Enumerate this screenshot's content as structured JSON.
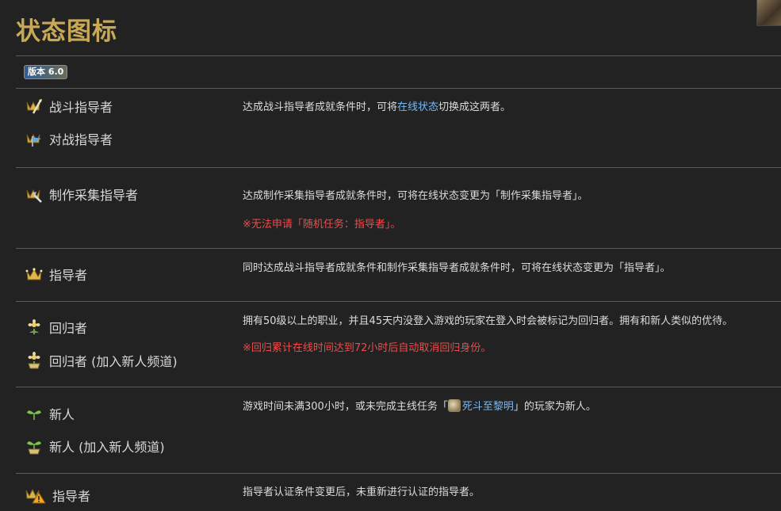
{
  "page": {
    "title": "状态图标"
  },
  "version_badge": "版本 6.0",
  "rows": [
    {
      "statuses": [
        {
          "label": "战斗指导者",
          "icon": "battle-mentor-icon"
        },
        {
          "label": "对战指导者",
          "icon": "pvp-mentor-icon"
        }
      ],
      "desc_pre": "达成战斗指导者成就条件时，可将",
      "desc_link": "在线状态",
      "desc_post": "切换成这两者。"
    },
    {
      "statuses": [
        {
          "label": "制作采集指导者",
          "icon": "trade-mentor-icon"
        }
      ],
      "desc": "达成制作采集指导者成就条件时，可将在线状态变更为「制作采集指导者」。",
      "note": "※无法申请「随机任务：指导者」。"
    },
    {
      "statuses": [
        {
          "label": "指导者",
          "icon": "mentor-crown-icon"
        }
      ],
      "desc": "同时达成战斗指导者成就条件和制作采集指导者成就条件时，可将在线状态变更为「指导者」。"
    },
    {
      "statuses": [
        {
          "label": "回归者",
          "icon": "returner-icon"
        },
        {
          "label": "回归者 (加入新人频道)",
          "icon": "returner-novice-network-icon"
        }
      ],
      "desc": "拥有50级以上的职业，并且45天内没登入游戏的玩家在登入时会被标记为回归者。拥有和新人类似的优待。",
      "note": "※回归累计在线时间达到72小时后自动取消回归身份。"
    },
    {
      "statuses": [
        {
          "label": "新人",
          "icon": "sprout-icon"
        },
        {
          "label": "新人 (加入新人频道)",
          "icon": "sprout-novice-network-icon"
        }
      ],
      "desc_pre": "游戏时间未满300小时，或未完成主线任务「",
      "desc_link": "死斗至黎明",
      "desc_post": "」的玩家为新人。"
    },
    {
      "statuses": [
        {
          "label": "指导者",
          "icon": "mentor-warning-icon"
        }
      ],
      "desc": "指导者认证条件变更后，未重新进行认证的指导者。"
    }
  ],
  "colors": {
    "title": "#c8a95a",
    "note": "#f04b4b",
    "link": "#79b7f0",
    "bg": "#222222"
  }
}
